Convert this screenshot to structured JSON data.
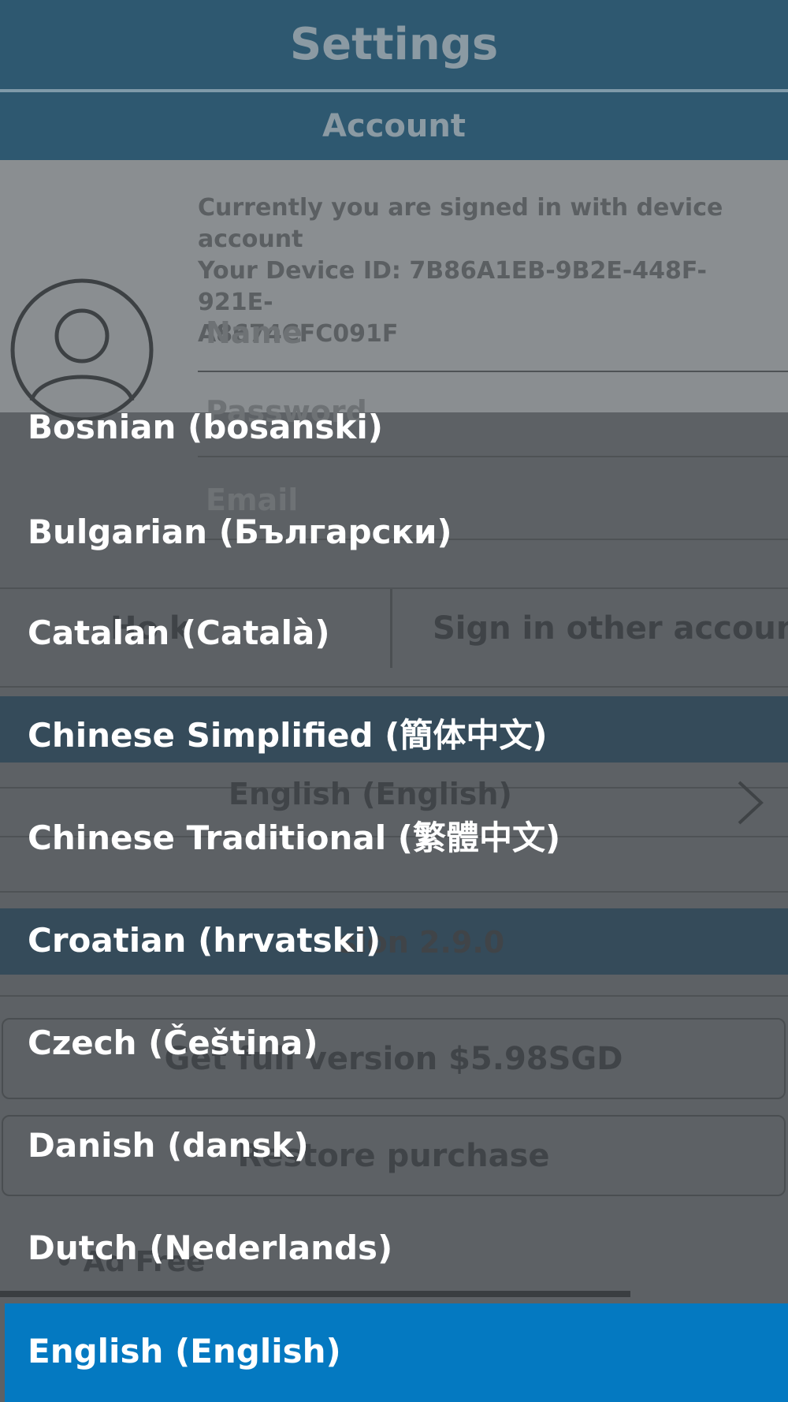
{
  "header": {
    "title": "Settings",
    "section_account": "Account"
  },
  "account": {
    "device_line1": "Currently you are signed in with device account",
    "device_line2": "Your Device ID: 7B86A1EB-9B2E-448F-921E-",
    "device_line3": "A8674CFC091F",
    "name_placeholder": "Name",
    "password_placeholder": "Password",
    "email_placeholder": "Email",
    "left_button_fragment": "Ho k",
    "right_button": "Sign in other account"
  },
  "language_section": {
    "current_value": "English (English)"
  },
  "version_section": {
    "version_fragment": "sion 2.9.0"
  },
  "purchase": {
    "full_version": "Get full version $5.98SGD",
    "restore": "Restore purchase",
    "ad_free": "Ad Free"
  },
  "language_picker": {
    "items": [
      "Bosnian (bosanski)",
      "Bulgarian (Български)",
      "Catalan (Català)",
      "Chinese Simplified (簡体中文)",
      "Chinese Traditional (繁體中文)",
      "Croatian (hrvatski)",
      "Czech (Čeština)",
      "Danish (dansk)",
      "Dutch (Nederlands)"
    ],
    "selected": "English (English)"
  },
  "colors": {
    "header_bg": "#2e5870",
    "overlay_bg": "#5d6165",
    "selected_bg": "#0479c1",
    "item_text": "#ffffff"
  },
  "icons": {
    "avatar": "user-avatar-icon",
    "chevron": "chevron-right-icon"
  }
}
